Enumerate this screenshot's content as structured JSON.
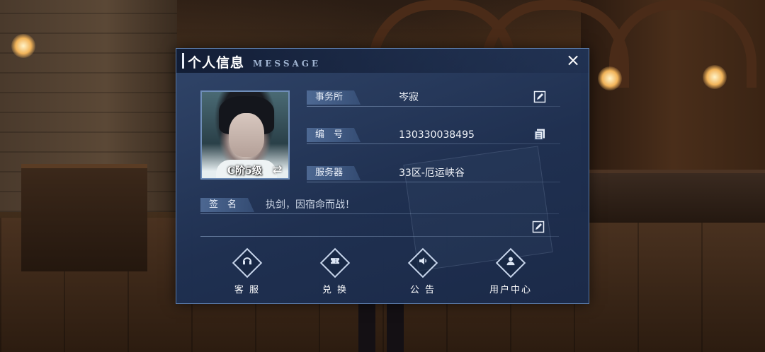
{
  "dialog": {
    "title": "个人信息",
    "subtitle": "MESSAGE",
    "close_icon": "×"
  },
  "profile": {
    "rank": "C阶5级",
    "swap_icon": "⇄",
    "fields": [
      {
        "label": "事务所",
        "value": "岑寂",
        "icon": "edit-icon"
      },
      {
        "label": "编　号",
        "value": "130330038495",
        "icon": "copy-icon"
      },
      {
        "label": "服务器",
        "value": "33区-厄运峡谷",
        "icon": ""
      }
    ],
    "signature": {
      "label": "签　名",
      "value": "执剑，因宿命而战！"
    }
  },
  "actions": [
    {
      "label": "客 服",
      "icon": "headset-icon"
    },
    {
      "label": "兑 换",
      "icon": "ticket-icon"
    },
    {
      "label": "公 告",
      "icon": "speaker-icon"
    },
    {
      "label": "用户中心",
      "icon": "user-icon"
    }
  ],
  "colors": {
    "panel": "#1e3052",
    "accent": "#5a78a5",
    "text": "#f2f5fa"
  }
}
